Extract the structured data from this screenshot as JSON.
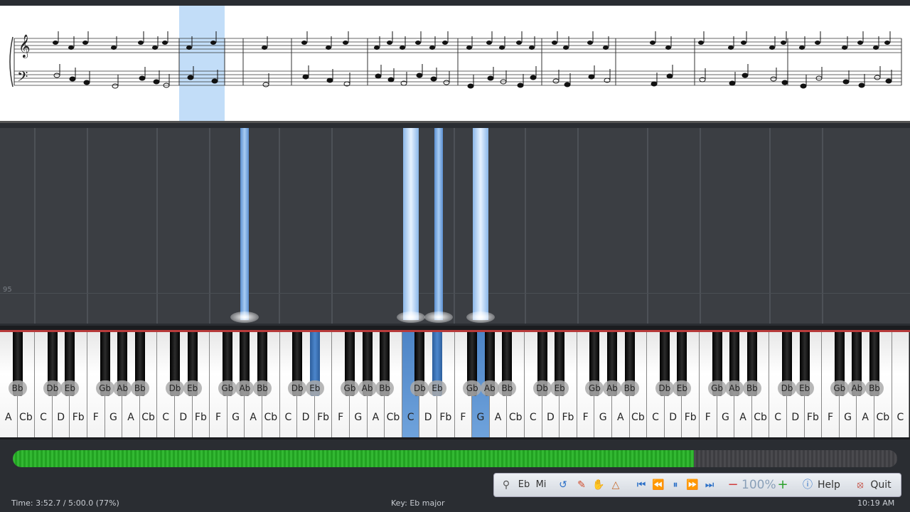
{
  "roll": {
    "tick_label": "95"
  },
  "keyboard": {
    "white_keys": [
      "A",
      "Cb",
      "C",
      "D",
      "Fb",
      "F",
      "G",
      "A",
      "Cb",
      "C",
      "D",
      "Fb",
      "F",
      "G",
      "A",
      "Cb",
      "C",
      "D",
      "Fb",
      "F",
      "G",
      "A",
      "Cb",
      "C",
      "D",
      "Fb",
      "F",
      "G",
      "A",
      "Cb",
      "C",
      "D",
      "Fb",
      "F",
      "G",
      "A",
      "Cb",
      "C",
      "D",
      "Fb",
      "F",
      "G",
      "A",
      "Cb",
      "C",
      "D",
      "Fb",
      "F",
      "G",
      "A",
      "Cb",
      "C"
    ],
    "active_white": [
      23,
      27
    ],
    "black_keys": [
      "Bb",
      "Db",
      "Eb",
      "Gb",
      "Ab",
      "Bb",
      "Db",
      "Eb",
      "Gb",
      "Ab",
      "Bb",
      "Db",
      "Eb",
      "Gb",
      "Ab",
      "Bb",
      "Db",
      "Eb",
      "Gb",
      "Ab",
      "Bb",
      "Db",
      "Eb",
      "Gb",
      "Ab",
      "Bb",
      "Db",
      "Eb",
      "Gb",
      "Ab",
      "Bb",
      "Db",
      "Eb",
      "Gb",
      "Ab",
      "Bb"
    ],
    "active_black": [
      12,
      17
    ]
  },
  "progress": {
    "fraction": 0.77
  },
  "toolbar": {
    "key_label": "Eb",
    "mode_label": "Mi",
    "zoom": "100%",
    "help_label": "Help",
    "quit_label": "Quit"
  },
  "status": {
    "time": "Time:  3:52.7 / 5:00.0 (77%)",
    "key": "Key: Eb major",
    "clock": "10:19 AM"
  },
  "colors": {
    "accent_blue": "#5b8fd0",
    "progress_green": "#2cb02c",
    "quit_red": "#c0392b"
  },
  "icons": [
    "search-icon",
    "loop-icon",
    "pencil-icon",
    "hand-icon",
    "metronome-icon",
    "skip-start-icon",
    "rewind-icon",
    "pause-icon",
    "forward-icon",
    "skip-end-icon",
    "minus-icon",
    "plus-icon",
    "help-icon",
    "quit-icon"
  ]
}
